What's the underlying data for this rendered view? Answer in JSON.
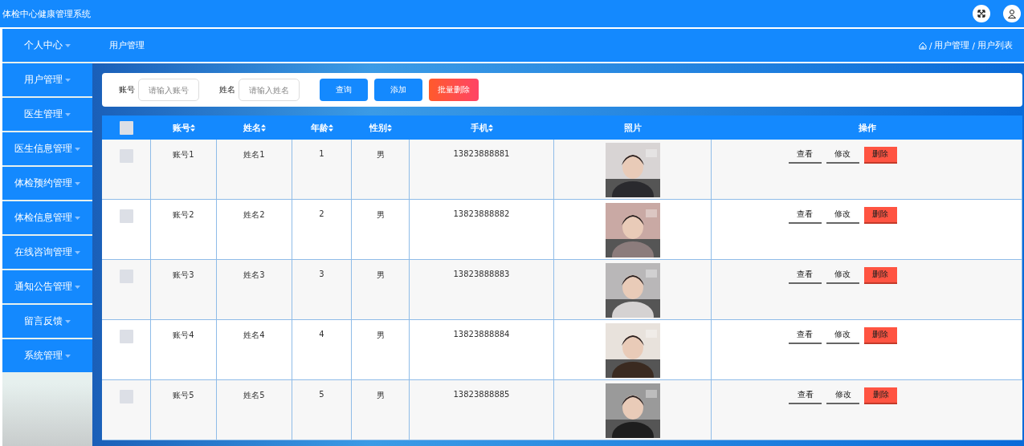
{
  "app_title": "体检中心健康管理系统",
  "sidebar": {
    "items": [
      {
        "label": "个人中心"
      },
      {
        "label": "用户管理"
      },
      {
        "label": "医生管理"
      },
      {
        "label": "医生信息管理"
      },
      {
        "label": "体检预约管理"
      },
      {
        "label": "体检信息管理"
      },
      {
        "label": "在线咨询管理"
      },
      {
        "label": "通知公告管理"
      },
      {
        "label": "留言反馈"
      },
      {
        "label": "系统管理"
      }
    ]
  },
  "page_title": "用户管理",
  "breadcrumb": [
    {
      "separator": "/",
      "label": "用户管理"
    },
    {
      "separator": "/",
      "label": "用户列表"
    }
  ],
  "search": {
    "fields": [
      {
        "label": "账号",
        "placeholder": "请输入账号"
      },
      {
        "label": "姓名",
        "placeholder": "请输入姓名"
      }
    ],
    "buttons": [
      {
        "label": "查询",
        "kind": "primary"
      },
      {
        "label": "添加",
        "kind": "primary"
      },
      {
        "label": "批量删除",
        "kind": "danger"
      }
    ]
  },
  "table": {
    "select_all": {
      "checked": false
    },
    "columns": [
      {
        "label": "账号",
        "sortable": true
      },
      {
        "label": "姓名",
        "sortable": true
      },
      {
        "label": "年龄",
        "sortable": true
      },
      {
        "label": "性别",
        "sortable": true
      },
      {
        "label": "手机",
        "sortable": true
      },
      {
        "label": "照片",
        "sortable": false
      },
      {
        "label": "操作",
        "sortable": false
      }
    ],
    "rows": [
      {
        "checked": false,
        "cells": [
          "账号1",
          "姓名1",
          "1",
          "男",
          "13823888881"
        ],
        "actions": [
          {
            "label": "查看",
            "kind": "plain"
          },
          {
            "label": "修改",
            "kind": "plain"
          },
          {
            "label": "删除",
            "kind": "danger"
          }
        ]
      },
      {
        "checked": false,
        "cells": [
          "账号2",
          "姓名2",
          "2",
          "男",
          "13823888882"
        ],
        "actions": [
          {
            "label": "查看",
            "kind": "plain"
          },
          {
            "label": "修改",
            "kind": "plain"
          },
          {
            "label": "删除",
            "kind": "danger"
          }
        ]
      },
      {
        "checked": false,
        "cells": [
          "账号3",
          "姓名3",
          "3",
          "男",
          "13823888883"
        ],
        "actions": [
          {
            "label": "查看",
            "kind": "plain"
          },
          {
            "label": "修改",
            "kind": "plain"
          },
          {
            "label": "删除",
            "kind": "danger"
          }
        ]
      },
      {
        "checked": false,
        "cells": [
          "账号4",
          "姓名4",
          "4",
          "男",
          "13823888884"
        ],
        "actions": [
          {
            "label": "查看",
            "kind": "plain"
          },
          {
            "label": "修改",
            "kind": "plain"
          },
          {
            "label": "删除",
            "kind": "danger"
          }
        ]
      },
      {
        "checked": false,
        "cells": [
          "账号5",
          "姓名5",
          "5",
          "男",
          "13823888885"
        ],
        "actions": [
          {
            "label": "查看",
            "kind": "plain"
          },
          {
            "label": "修改",
            "kind": "plain"
          },
          {
            "label": "删除",
            "kind": "danger"
          }
        ]
      }
    ]
  }
}
